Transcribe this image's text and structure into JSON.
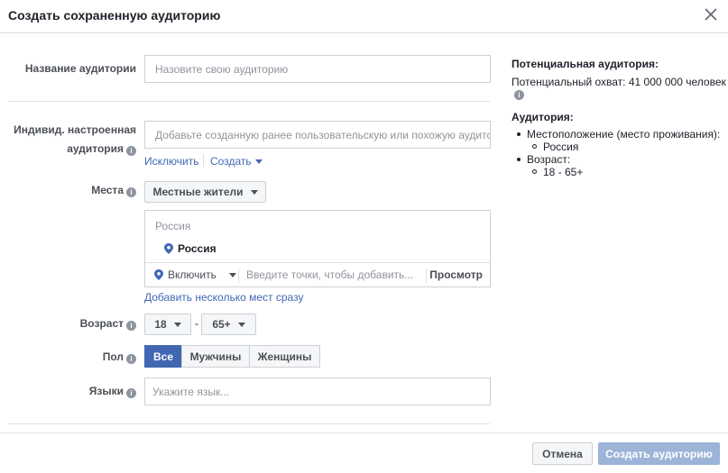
{
  "dialog": {
    "title": "Создать сохраненную аудиторию"
  },
  "form": {
    "name_label": "Название аудитории",
    "name_placeholder": "Назовите свою аудиторию",
    "custom_label_line1": "Индивид. настроенная",
    "custom_label_line2": "аудитория",
    "custom_placeholder": "Добавьте созданную ранее пользовательскую или похожую аудитор",
    "exclude_link": "Исключить",
    "create_link": "Создать",
    "locations_label": "Места",
    "locations_type": "Местные жители",
    "locations_search": "Россия",
    "location_selected": "Россия",
    "include_label": "Включить",
    "location_input_placeholder": "Введите точки, чтобы добавить...",
    "browse_label": "Просмотр",
    "add_multiple_link": "Добавить несколько мест сразу",
    "age_label": "Возраст",
    "age_min": "18",
    "age_sep": "-",
    "age_max": "65+",
    "gender_label": "Пол",
    "gender_all": "Все",
    "gender_men": "Мужчины",
    "gender_women": "Женщины",
    "languages_label": "Языки",
    "languages_placeholder": "Укажите язык..."
  },
  "sidebar": {
    "potential_heading": "Потенциальная аудитория:",
    "potential_reach": "Потенциальный охват: 41 000 000 человек",
    "audience_heading": "Аудитория:",
    "location_item": "Местоположение (место проживания):",
    "location_value": "Россия",
    "age_item": "Возраст:",
    "age_value": "18 - 65+"
  },
  "footer": {
    "cancel_label": "Отмена",
    "create_label": "Создать аудиторию"
  },
  "colors": {
    "accent": "#4267b2",
    "link": "#4267b2",
    "disabled_button": "#9cb4d8"
  },
  "icons": {
    "close": "close-icon",
    "info": "info-icon",
    "pin": "location-pin-icon"
  }
}
